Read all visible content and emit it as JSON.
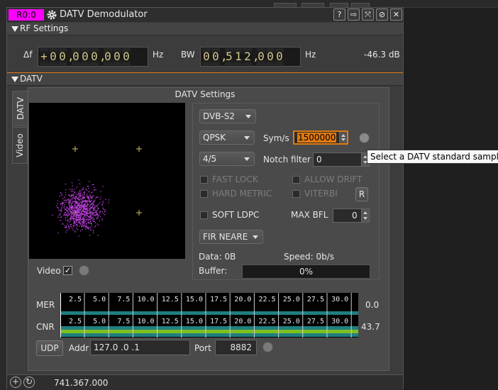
{
  "window": {
    "tag": "R0:0",
    "title": "DATV Demodulator",
    "titlebar_buttons": [
      "help-icon",
      "move-to-workspace-icon",
      "expand-icon",
      "hide-icon",
      "close-icon"
    ]
  },
  "rf_settings": {
    "header": "RF Settings",
    "df_label": "Δf",
    "df_digits": [
      "+",
      "0",
      "0",
      ",",
      "0",
      "0",
      "0",
      ",",
      "0",
      "0",
      "0"
    ],
    "df_unit": "Hz",
    "bw_label": "BW",
    "bw_digits": [
      "0",
      "0",
      ",",
      "5",
      "1",
      "2",
      ",",
      "0",
      "0",
      "0"
    ],
    "bw_unit": "Hz",
    "power": "-46.3 dB"
  },
  "datv": {
    "header": "DATV",
    "tabs": [
      {
        "label": "DATV",
        "active": true
      },
      {
        "label": "Video",
        "active": false
      }
    ],
    "panel_title": "DATV Settings",
    "standard": "DVB-S2",
    "modulation": "QPSK",
    "symrate_label": "Sym/s",
    "symrate_value": "1500000",
    "fec": "4/5",
    "notch_label": "Notch filter",
    "notch_value": "0",
    "fast_lock_label": "FAST LOCK",
    "allow_drift_label": "ALLOW DRIFT",
    "hard_metric_label": "HARD METRIC",
    "viterbi_label": "VITERBI",
    "reset_label": "R",
    "soft_ldpc_label": "SOFT LDPC",
    "max_bfl_label": "MAX BFL",
    "max_bfl_value": "0",
    "filter": "FIR NEARE",
    "data_label": "Data: 0B",
    "speed_label": "Speed: 0b/s",
    "buffer_label": "Buffer:",
    "buffer_value": "0%",
    "buffer_fraction": 0,
    "video_label": "Video",
    "video_check": "✓",
    "tooltip": "Select a DATV standard sample rate"
  },
  "meters": {
    "ticks": [
      "2.5",
      "5.0",
      "7.5",
      "10.0",
      "12.5",
      "15.0",
      "17.5",
      "20.0",
      "22.5",
      "25.0",
      "27.5",
      "30.0"
    ],
    "mer": {
      "label": "MER",
      "value": "0.0"
    },
    "cnr": {
      "label": "CNR",
      "value": "43.7"
    }
  },
  "udp": {
    "button": "UDP",
    "addr_label": "Addr",
    "addr_value": "127.0 .0 .1",
    "port_label": "Port",
    "port_value": "8882"
  },
  "status": {
    "frequency": "741.367.000"
  },
  "colors": {
    "tag_bg": "#ff00ff",
    "constellation_points": "#c040e0",
    "mer_bar": "#1f7f7f",
    "cnr_bar": "#7fbf1f",
    "symrate_highlight": "#e07a10"
  }
}
